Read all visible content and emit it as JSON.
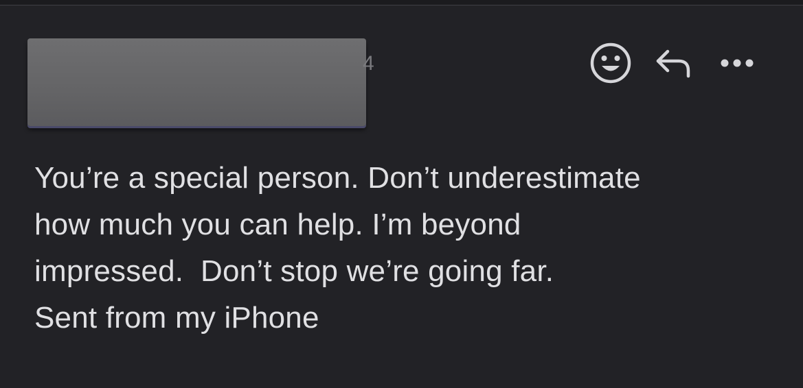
{
  "colors": {
    "background": "#222226",
    "text": "#e0e0e3",
    "icon": "#d6d6da",
    "redaction": "#666668"
  },
  "header": {
    "sender_visible_suffix": "4",
    "actions": [
      {
        "name": "emoji-reaction",
        "icon": "smiley-face-icon"
      },
      {
        "name": "reply",
        "icon": "reply-arrow-icon"
      },
      {
        "name": "more",
        "icon": "ellipsis-icon"
      }
    ]
  },
  "message": {
    "lines": [
      "You’re a special person. Don’t underestimate",
      "how much you can help. I’m beyond",
      "impressed.  Don’t stop we’re going far.",
      "Sent from my iPhone"
    ]
  }
}
